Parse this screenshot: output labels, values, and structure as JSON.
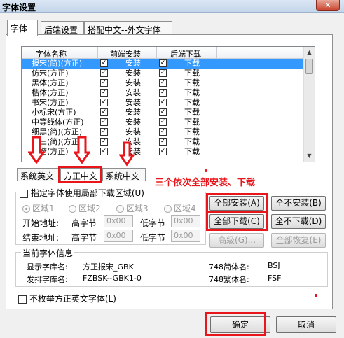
{
  "window": {
    "title": "字体设置",
    "close": "✕"
  },
  "tabs": [
    "字体",
    "后端设置",
    "搭配中文--外文字体"
  ],
  "list": {
    "headers": [
      "字体名称",
      "前端安装",
      "后端下载"
    ],
    "check_mark": "✓",
    "rows": [
      {
        "name": "报宋(简)(方正)",
        "front": "安装",
        "back": "下载"
      },
      {
        "name": "仿宋(方正)",
        "front": "安装",
        "back": "下载"
      },
      {
        "name": "黑体(方正)",
        "front": "安装",
        "back": "下载"
      },
      {
        "name": "楷体(方正)",
        "front": "安装",
        "back": "下载"
      },
      {
        "name": "书宋(方正)",
        "front": "安装",
        "back": "下载"
      },
      {
        "name": "小标宋(方正)",
        "front": "安装",
        "back": "下载"
      },
      {
        "name": "中等线体(方正)",
        "front": "安装",
        "back": "下载"
      },
      {
        "name": "细黑(简)(方正)",
        "front": "安装",
        "back": "下载"
      },
      {
        "name": "报三(简)(方正)",
        "front": "安装",
        "back": "下载"
      },
      {
        "name": "行楷(方正)",
        "front": "安装",
        "back": "下载"
      }
    ]
  },
  "subtabs": [
    "系统英文",
    "方正中文",
    "系统中文"
  ],
  "annotation": "三个依次全部安装、下载",
  "partial_download": {
    "checkbox_label": "指定字体使用局部下载区域(U)",
    "regions": [
      "区域1",
      "区域2",
      "区域3",
      "区域4"
    ],
    "start_label": "开始地址:",
    "end_label": "结束地址:",
    "high_byte": "高字节",
    "low_byte": "低字节",
    "hex_value": "0x00"
  },
  "buttons": {
    "install_all": "全部安装(A)",
    "uninstall_all": "全不安装(B)",
    "download_all": "全部下载(C)",
    "undownload_all": "全不下载(D)",
    "advanced": "高级(G)...",
    "restore_all": "全部恢复(E)",
    "ok": "确定",
    "cancel": "取消"
  },
  "font_info": {
    "title": "当前字体信息",
    "display_label": "显示字库名:",
    "display_value": "方正报宋_GBK",
    "typeset_label": "发排字库名:",
    "typeset_value": "FZBSK--GBK1-0",
    "simp_label": "748简体名:",
    "simp_value": "BSJ",
    "trad_label": "748繁体名:",
    "trad_value": "FSF"
  },
  "no_list_english": "不枚举方正英文字体(L)",
  "colors": {
    "highlight": "#e8161b",
    "selection": "#3399ff"
  }
}
